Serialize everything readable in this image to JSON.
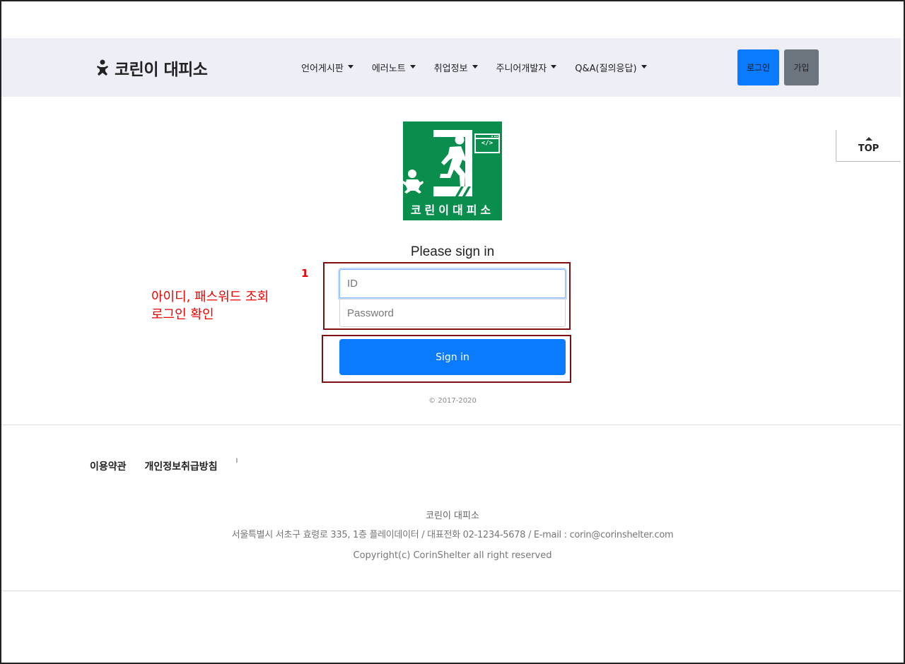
{
  "brand": {
    "name": "코린이 대피소",
    "icon": "baby-icon"
  },
  "nav": {
    "items": [
      {
        "label": "언어게시판"
      },
      {
        "label": "에러노트"
      },
      {
        "label": "취업정보"
      },
      {
        "label": "주니어개발자"
      },
      {
        "label": "Q&A(질의응답)"
      }
    ],
    "login_label": "로그인",
    "join_label": "가입"
  },
  "top_button": {
    "label": "TOP"
  },
  "logo": {
    "text": "코린이대피소",
    "code_symbol": "</>"
  },
  "signin": {
    "title": "Please sign in",
    "id_placeholder": "ID",
    "password_placeholder": "Password",
    "button_label": "Sign in",
    "copyright": "© 2017-2020"
  },
  "annotation": {
    "number": "1",
    "line1": "아이디, 패스워드 조회",
    "line2": "로그인 확인"
  },
  "footer": {
    "links": [
      "이용약관",
      "개인정보취급방침"
    ],
    "separator": "I",
    "company": "코린이 대피소",
    "address": "서울특별시 서초구 효령로 335, 1층 플레이데이터 / 대표전화 02-1234-5678 / E-mail : corin@corinshelter.com",
    "copyright": "Copyright(c) CorinShelter all right reserved"
  },
  "colors": {
    "primary": "#0a7bff",
    "secondary": "#6c757d",
    "navbar_bg": "#eeeef7",
    "logo_green": "#0a8e4e",
    "annotation_red": "#e00000",
    "annotation_border": "#7a1010"
  }
}
